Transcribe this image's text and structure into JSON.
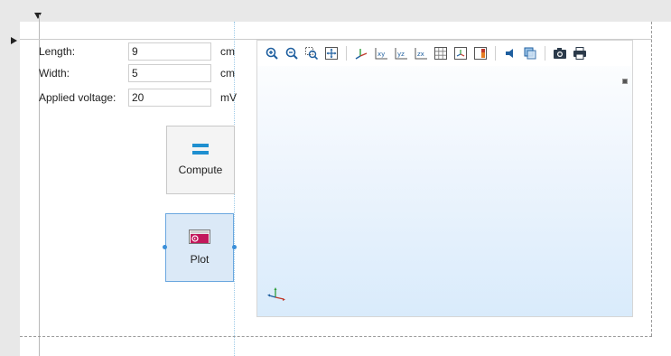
{
  "form": {
    "length": {
      "label": "Length:",
      "value": "9",
      "unit": "cm"
    },
    "width": {
      "label": "Width:",
      "value": "5",
      "unit": "cm"
    },
    "voltage": {
      "label": "Applied voltage:",
      "value": "20",
      "unit": "mV"
    }
  },
  "buttons": {
    "compute": {
      "label": "Compute",
      "icon": "equals-icon"
    },
    "plot": {
      "label": "Plot",
      "icon": "plot-icon"
    }
  },
  "toolbar": {
    "icons": [
      "zoom-in-icon",
      "zoom-out-icon",
      "zoom-box-icon",
      "zoom-extents-icon",
      "default-view-icon",
      "xy-view-icon",
      "yz-view-icon",
      "zx-view-icon",
      "grid-icon",
      "axis-orientation-icon",
      "color-legend-icon",
      "light-icon",
      "transparency-icon",
      "camera-icon",
      "print-icon"
    ]
  },
  "colors": {
    "accent": "#1f8fd0",
    "selection": "#6aa7df",
    "plot_gradient_bottom": "#d9ebfb",
    "guide_line": "#9ecbe8"
  }
}
